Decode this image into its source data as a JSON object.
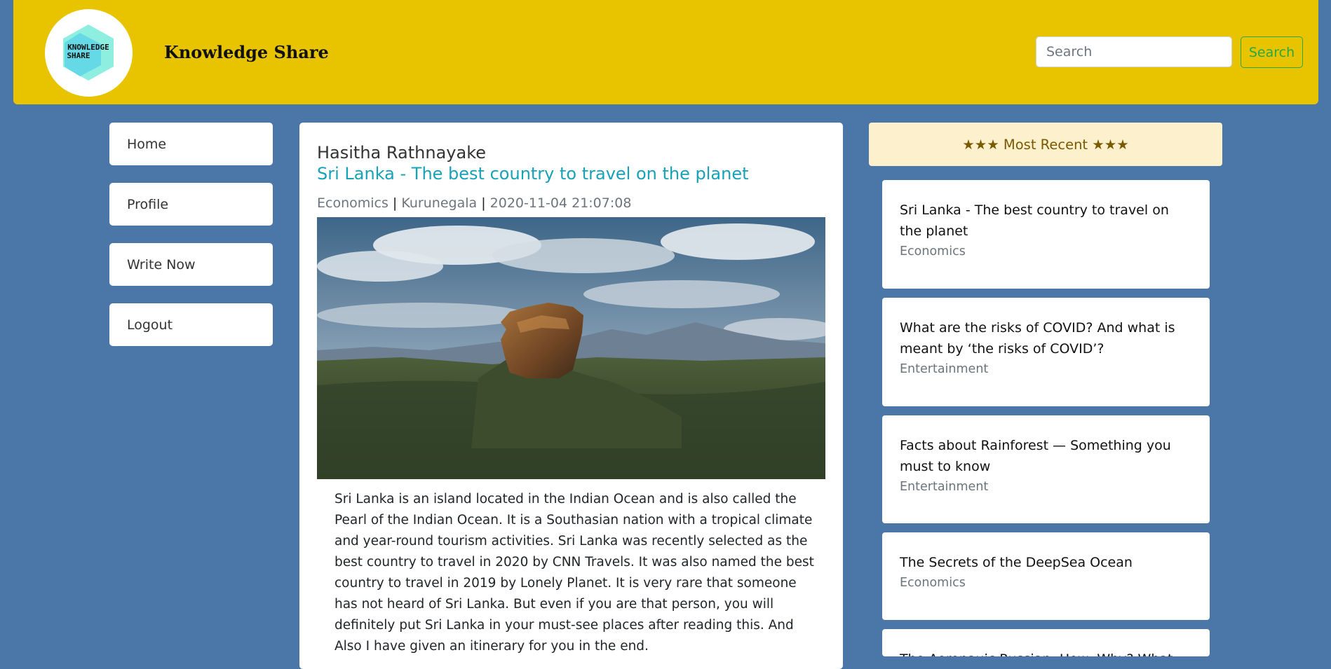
{
  "header": {
    "logo_text": "KNOWLEDGE SHARE",
    "site_title": "Knowledge Share",
    "search_placeholder": "Search",
    "search_button": "Search",
    "accent_color": "#e8c400",
    "background_color": "#4b76a8"
  },
  "nav": {
    "items": [
      {
        "label": "Home"
      },
      {
        "label": "Profile"
      },
      {
        "label": "Write Now"
      },
      {
        "label": "Logout"
      }
    ]
  },
  "post": {
    "author": "Hasitha Rathnayake",
    "title": "Sri Lanka - The best country to travel on the planet",
    "category": "Economics",
    "location": "Kurunegala",
    "date": "2020-11-04 21:07:08",
    "separator": "|",
    "image": "sigiriya-rock-landscape",
    "body": "Sri Lanka is an island located in the Indian Ocean and is also called the Pearl of the Indian Ocean. It is a Southasian nation with a tropical climate and year-round tourism activities. Sri Lanka was recently selected as the best country to travel in 2020 by CNN Travels. It was also named the best country to travel in 2019 by Lonely Planet. It is very rare that someone has not heard of Sri Lanka. But even if you are that person, you will definitely put Sri Lanka in your must-see places after reading this. And Also I have given an itinerary for you in the end."
  },
  "recent": {
    "header": "★★★ Most Recent ★★★",
    "items": [
      {
        "title": "Sri Lanka - The best country to travel on the planet",
        "category": "Economics"
      },
      {
        "title": "What are the risks of COVID? And what is meant by ‘the risks of COVID’?",
        "category": "Entertainment"
      },
      {
        "title": "Facts about Rainforest — Something you must to know",
        "category": "Entertainment"
      },
      {
        "title": "The Secrets of the DeepSea Ocean",
        "category": "Economics"
      },
      {
        "title": "The Aeronauic Russian: How, Why? What",
        "category": ""
      }
    ]
  }
}
